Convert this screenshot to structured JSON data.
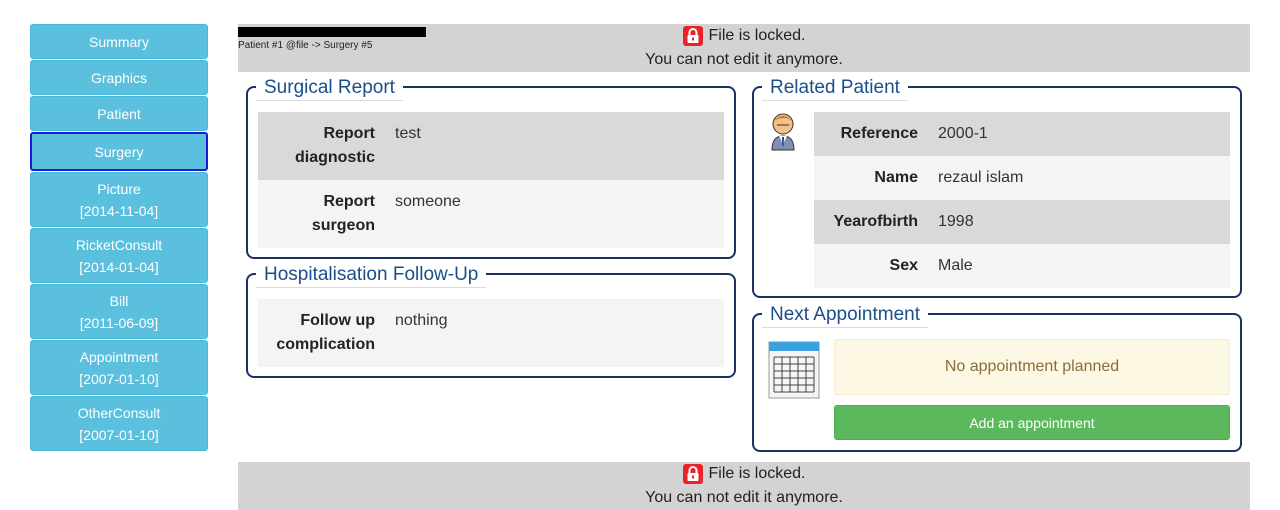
{
  "sidebar": {
    "items": [
      {
        "label": "Summary",
        "date": ""
      },
      {
        "label": "Graphics",
        "date": ""
      },
      {
        "label": "Patient",
        "date": ""
      },
      {
        "label": "Surgery",
        "date": ""
      },
      {
        "label": "Picture",
        "date": "[2014-11-04]"
      },
      {
        "label": "RicketConsult",
        "date": "[2014-01-04]"
      },
      {
        "label": "Bill",
        "date": "[2011-06-09]"
      },
      {
        "label": "Appointment",
        "date": "[2007-01-10]"
      },
      {
        "label": "OtherConsult",
        "date": "[2007-01-10]"
      }
    ],
    "active": "Surgery"
  },
  "breadcrumb": "Patient #1 @file -> Surgery #5",
  "lock": {
    "line1": "File is locked.",
    "line2": "You can not edit it anymore.",
    "icon": "lock-icon",
    "color": "#e8232a"
  },
  "surgical_report": {
    "title": "Surgical Report",
    "rows": [
      {
        "key_line1": "Report",
        "key_line2": "diagnostic",
        "value": "test"
      },
      {
        "key_line1": "Report",
        "key_line2": "surgeon",
        "value": "someone"
      }
    ]
  },
  "hospitalisation": {
    "title": "Hospitalisation Follow-Up",
    "rows": [
      {
        "key_line1": "Follow up",
        "key_line2": "complication",
        "value": "nothing"
      }
    ]
  },
  "related_patient": {
    "title": "Related Patient",
    "rows": [
      {
        "key": "Reference",
        "value": "2000-1"
      },
      {
        "key": "Name",
        "value": "rezaul islam"
      },
      {
        "key": "Yearofbirth",
        "value": "1998"
      },
      {
        "key": "Sex",
        "value": "Male"
      }
    ]
  },
  "next_appointment": {
    "title": "Next Appointment",
    "empty_text": "No appointment planned",
    "add_label": "Add an appointment"
  },
  "colors": {
    "nav": "#5bc0de",
    "legend": "#1b4f8a",
    "success": "#5cb85c",
    "warning_bg": "#fcf8e3"
  }
}
